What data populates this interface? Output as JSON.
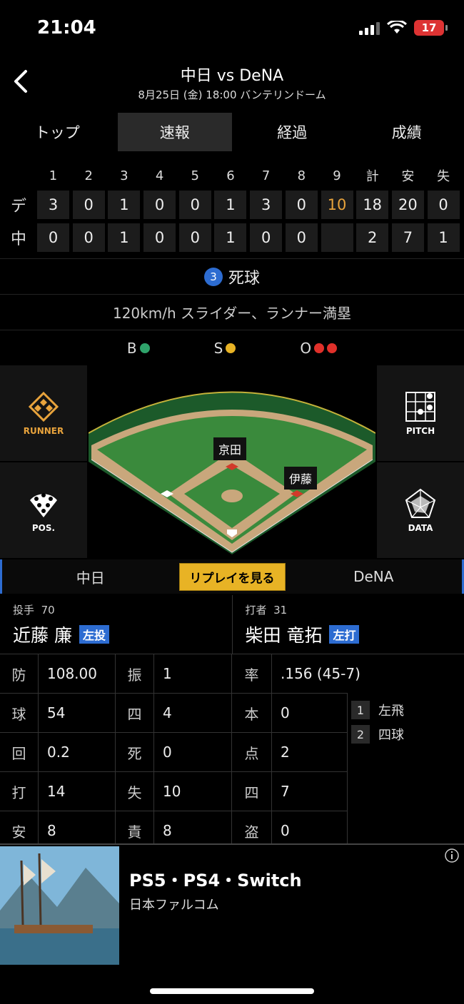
{
  "status": {
    "time": "21:04",
    "battery": "17"
  },
  "header": {
    "title": "中日 vs DeNA",
    "subtitle": "8月25日 (金) 18:00 バンテリンドーム"
  },
  "tabs": [
    "トップ",
    "速報",
    "経過",
    "成績"
  ],
  "scoreboard": {
    "headers": [
      "1",
      "2",
      "3",
      "4",
      "5",
      "6",
      "7",
      "8",
      "9",
      "計",
      "安",
      "失"
    ],
    "rows": [
      {
        "team": "デ",
        "cells": [
          "3",
          "0",
          "1",
          "0",
          "0",
          "1",
          "3",
          "0",
          "10",
          "18",
          "20",
          "0"
        ]
      },
      {
        "team": "中",
        "cells": [
          "0",
          "0",
          "1",
          "0",
          "0",
          "1",
          "0",
          "0",
          "",
          "2",
          "7",
          "1"
        ]
      }
    ]
  },
  "play": {
    "number": "3",
    "result": "死球",
    "pitch": "120km/h スライダー、ランナー満塁"
  },
  "count": {
    "b": "B",
    "s": "S",
    "o": "O",
    "colors": {
      "ball": "#2fa36b",
      "strike": "#e8b325",
      "out": "#e0302a"
    }
  },
  "field": {
    "runner_label": "RUNNER",
    "pos_label": "POS.",
    "pitch_label": "PITCH",
    "data_label": "DATA",
    "runner_second": "京田",
    "runner_third": "伊藤"
  },
  "teams": {
    "left": "中日",
    "replay": "リプレイを見る",
    "right": "DeNA"
  },
  "pitcher": {
    "role": "投手",
    "number": "70",
    "name": "近藤 廉",
    "hand": "左投"
  },
  "batter": {
    "role": "打者",
    "number": "31",
    "name": "柴田 竜拓",
    "hand": "左打"
  },
  "pitcher_stats": [
    {
      "k1": "防",
      "v1": "108.00",
      "k2": "振",
      "v2": "1"
    },
    {
      "k1": "球",
      "v1": "54",
      "k2": "四",
      "v2": "4"
    },
    {
      "k1": "回",
      "v1": "0.2",
      "k2": "死",
      "v2": "0"
    },
    {
      "k1": "打",
      "v1": "14",
      "k2": "失",
      "v2": "10"
    },
    {
      "k1": "安",
      "v1": "8",
      "k2": "責",
      "v2": "8"
    }
  ],
  "batter_stats": {
    "avg_key": "率",
    "avg_val": ".156 (45-7)",
    "rows": [
      {
        "k": "本",
        "v": "0"
      },
      {
        "k": "点",
        "v": "2"
      },
      {
        "k": "四",
        "v": "7"
      },
      {
        "k": "盗",
        "v": "0"
      }
    ],
    "at_bats": [
      {
        "n": "1",
        "r": "左飛"
      },
      {
        "n": "2",
        "r": "四球"
      }
    ]
  },
  "ad": {
    "title": "PS5・PS4・Switch",
    "sub": "日本ファルコム"
  }
}
